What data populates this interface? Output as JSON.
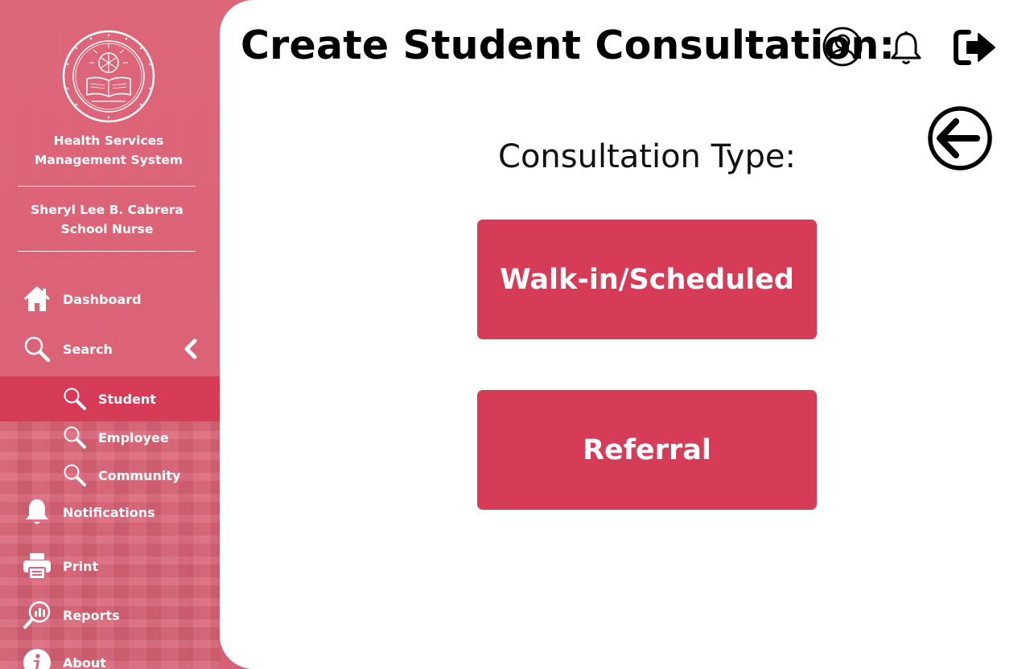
{
  "app": {
    "title_line1": "Health Services",
    "title_line2": "Management System"
  },
  "user": {
    "name": "Sheryl Lee B. Cabrera",
    "role": "School Nurse"
  },
  "sidebar": {
    "items": [
      {
        "label": "Dashboard",
        "icon": "home-icon"
      },
      {
        "label": "Search",
        "icon": "search-icon"
      },
      {
        "label": "Notifications",
        "icon": "bell-icon"
      },
      {
        "label": "Print",
        "icon": "printer-icon"
      },
      {
        "label": "Reports",
        "icon": "reports-icon"
      },
      {
        "label": "About",
        "icon": "info-icon"
      }
    ],
    "search_sub": [
      {
        "label": "Student",
        "icon": "search-icon",
        "active": true
      },
      {
        "label": "Employee",
        "icon": "search-icon"
      },
      {
        "label": "Community",
        "icon": "search-icon"
      }
    ]
  },
  "header": {
    "title": "Create Student Consultation:",
    "icons": [
      "user-circle-icon",
      "bell-icon",
      "logout-icon"
    ]
  },
  "main": {
    "section_label": "Consultation Type:",
    "buttons": {
      "walkin": "Walk-in/Scheduled",
      "referral": "Referral"
    },
    "back_icon": "arrow-left-circle-icon"
  },
  "colors": {
    "sidebar_bg": "#dc6478",
    "accent": "#d63c58",
    "main_bg": "#ffffff"
  }
}
